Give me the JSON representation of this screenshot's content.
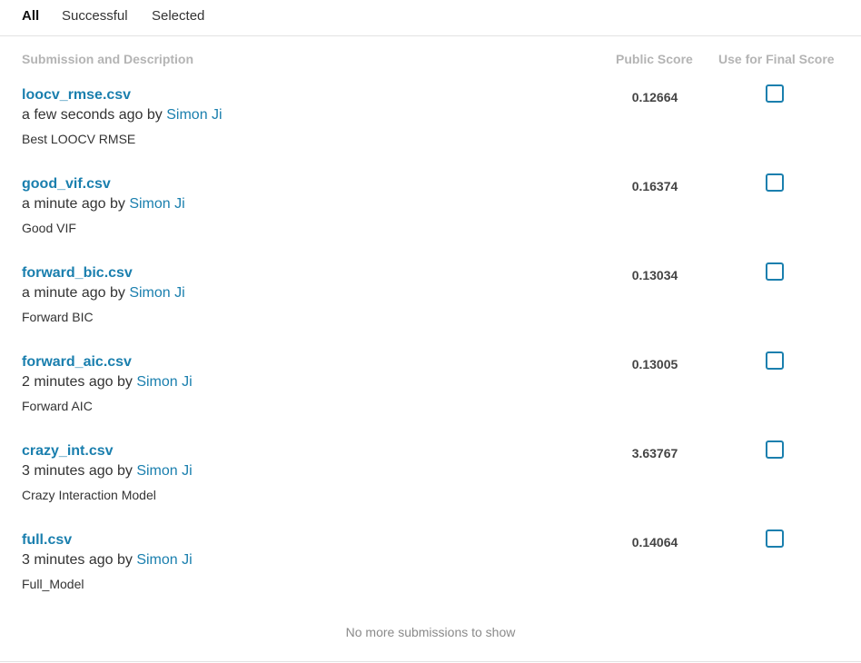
{
  "tabs": [
    {
      "label": "All",
      "active": true
    },
    {
      "label": "Successful",
      "active": false
    },
    {
      "label": "Selected",
      "active": false
    }
  ],
  "columns": {
    "submission": "Submission and Description",
    "public_score": "Public Score",
    "final_score": "Use for Final Score"
  },
  "submissions": [
    {
      "file": "loocv_rmse.csv",
      "time": "a few seconds ago",
      "by": "by",
      "author": "Simon Ji",
      "description": "Best LOOCV RMSE",
      "score": "0.12664",
      "selected": false
    },
    {
      "file": "good_vif.csv",
      "time": "a minute ago",
      "by": "by",
      "author": "Simon Ji",
      "description": "Good VIF",
      "score": "0.16374",
      "selected": false
    },
    {
      "file": "forward_bic.csv",
      "time": "a minute ago",
      "by": "by",
      "author": "Simon Ji",
      "description": "Forward BIC",
      "score": "0.13034",
      "selected": false
    },
    {
      "file": "forward_aic.csv",
      "time": "2 minutes ago",
      "by": "by",
      "author": "Simon Ji",
      "description": "Forward AIC",
      "score": "0.13005",
      "selected": false
    },
    {
      "file": "crazy_int.csv",
      "time": "3 minutes ago",
      "by": "by",
      "author": "Simon Ji",
      "description": "Crazy Interaction Model",
      "score": "3.63767",
      "selected": false
    },
    {
      "file": "full.csv",
      "time": "3 minutes ago",
      "by": "by",
      "author": "Simon Ji",
      "description": "Full_Model",
      "score": "0.14064",
      "selected": false
    }
  ],
  "footer": "No more submissions to show",
  "colors": {
    "link": "#1a7fae",
    "header": "#b4b4b4",
    "text": "#333333",
    "divider": "#e2e2e2"
  }
}
